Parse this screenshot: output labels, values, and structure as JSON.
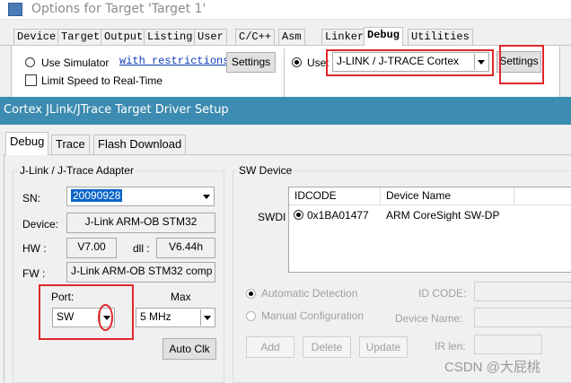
{
  "back_window": {
    "title": "Options for Target 'Target 1'",
    "tabs": [
      "Device",
      "Target",
      "Output",
      "Listing",
      "User",
      "C/C++",
      "Asm",
      "Linker",
      "Debug",
      "Utilities"
    ],
    "use_simulator": "Use Simulator",
    "with_restrictions": "with restrictions",
    "settings_left": "Settings",
    "limit_speed": "Limit Speed to Real-Time",
    "use_label": "Use:",
    "debugger": "J-LINK / J-TRACE Cortex",
    "settings_right": "Settings",
    "icon": "keil-window-icon"
  },
  "dialog": {
    "title": "Cortex JLink/JTrace Target Driver Setup",
    "tabs": [
      "Debug",
      "Trace",
      "Flash Download"
    ],
    "adapter": {
      "group": "J-Link / J-Trace Adapter",
      "sn_label": "SN:",
      "sn_value": "20090928",
      "device_label": "Device:",
      "device_value": "J-Link ARM-OB STM32",
      "hw_label": "HW :",
      "hw_value": "V7.00",
      "dll_label": "dll :",
      "dll_value": "V6.44h",
      "fw_label": "FW :",
      "fw_value": "J-Link ARM-OB STM32 comp",
      "port_label": "Port:",
      "port_value": "SW",
      "max_label": "Max",
      "max_value": "5 MHz",
      "auto_clk": "Auto Clk"
    },
    "sw_device": {
      "group": "SW Device",
      "columns": [
        "IDCODE",
        "Device Name"
      ],
      "swdi_label": "SWDI",
      "rows": [
        {
          "idcode": "0x1BA01477",
          "name": "ARM CoreSight SW-DP"
        }
      ],
      "automatic_detection": "Automatic Detection",
      "manual_configuration": "Manual Configuration",
      "id_code_label": "ID CODE:",
      "device_name_label": "Device Name:",
      "ir_len_label": "IR len:",
      "add": "Add",
      "delete": "Delete",
      "update": "Update"
    }
  },
  "watermark": "CSDN @大屁桃",
  "colors": {
    "title_bar": "#3c8bb0",
    "highlight": "#e0262b",
    "selection": "#0a64c8"
  }
}
